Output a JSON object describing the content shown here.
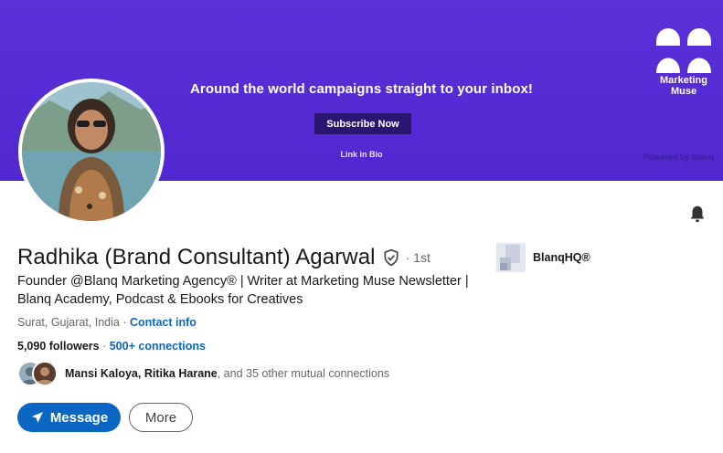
{
  "banner": {
    "headline": "Around the world campaigns straight to your inbox!",
    "cta_label": "Subscribe Now",
    "link_text": "Link in Bio",
    "powered_by": "Powered by blanq",
    "brand_name_line1": "Marketing",
    "brand_name_line2": "Muse",
    "background_color": "#5a31d8"
  },
  "profile": {
    "name": "Radhika (Brand Consultant) Agarwal",
    "degree": "· 1st",
    "headline": "Founder @Blanq Marketing Agency® | Writer at Marketing Muse Newsletter | Blanq Academy, Podcast & Ebooks for Creatives",
    "location": "Surat, Gujarat, India",
    "location_sep": " · ",
    "contact_info_label": "Contact info",
    "followers": "5,090 followers",
    "connections_sep": " · ",
    "connections": "500+ connections",
    "mutual_names": "Mansi Kaloya, Ritika Harane",
    "mutual_rest": ", and 35 other mutual connections"
  },
  "actions": {
    "message_label": "Message",
    "more_label": "More"
  },
  "company": {
    "name": "BlanqHQ®"
  },
  "colors": {
    "accent": "#0a66c2",
    "banner": "#5a31d8"
  },
  "icons": {
    "bell": "bell-icon",
    "verified": "verified-shield-icon",
    "send": "send-icon"
  }
}
